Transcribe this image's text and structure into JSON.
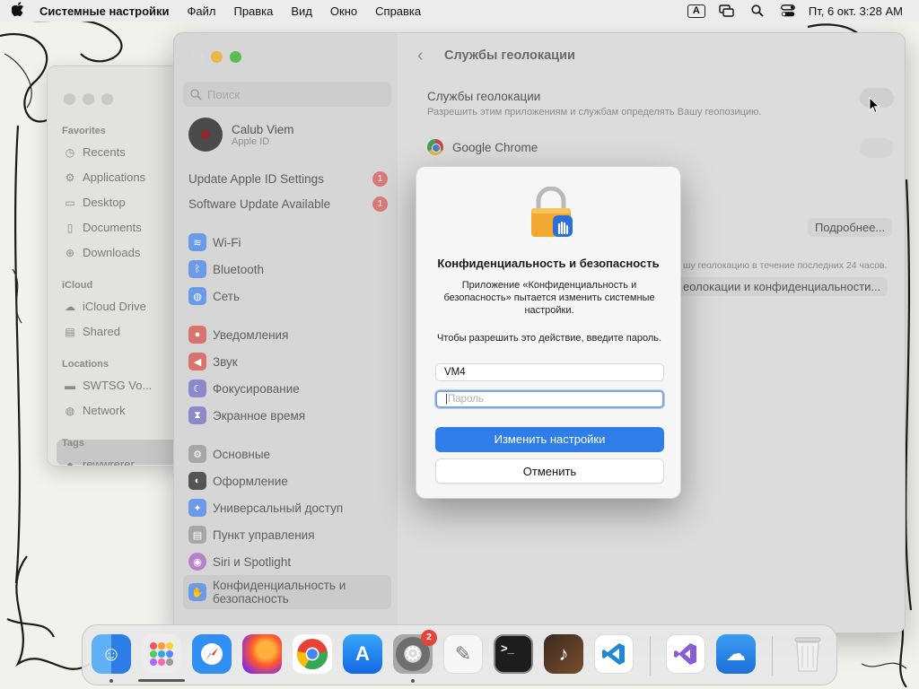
{
  "menubar": {
    "app_name": "Системные настройки",
    "menus": [
      "Файл",
      "Правка",
      "Вид",
      "Окно",
      "Справка"
    ],
    "input_badge": "A",
    "clock": "Пт, 6 окт.  3:28 AM"
  },
  "finder": {
    "sections": [
      {
        "title": "Favorites",
        "items": [
          "Recents",
          "Applications",
          "Desktop",
          "Documents",
          "Downloads"
        ]
      },
      {
        "title": "iCloud",
        "items": [
          "iCloud Drive",
          "Shared"
        ]
      },
      {
        "title": "Locations",
        "items": [
          "SWTSG Vo...",
          "Network"
        ]
      },
      {
        "title": "Tags",
        "items": [
          "rewwrerer"
        ]
      }
    ]
  },
  "settings": {
    "search_placeholder": "Поиск",
    "profile": {
      "name": "Calub Viem",
      "sub": "Apple ID"
    },
    "notices": [
      {
        "label": "Update Apple ID Settings",
        "count": "1"
      },
      {
        "label": "Software Update Available",
        "count": "1"
      }
    ],
    "sidebar_items": [
      {
        "label": "Wi-Fi",
        "icon": "wifi-icon",
        "color": "#3b82f6"
      },
      {
        "label": "Bluetooth",
        "icon": "bluetooth-icon",
        "color": "#3b82f6"
      },
      {
        "label": "Сеть",
        "icon": "globe-icon",
        "color": "#3b82f6"
      },
      {
        "label": "Уведомления",
        "icon": "bell-icon",
        "color": "#e5453b"
      },
      {
        "label": "Звук",
        "icon": "speaker-icon",
        "color": "#e5453b"
      },
      {
        "label": "Фокусирование",
        "icon": "moon-icon",
        "color": "#5856d6"
      },
      {
        "label": "Экранное время",
        "icon": "hourglass-icon",
        "color": "#5856d6"
      },
      {
        "label": "Основные",
        "icon": "gear-icon",
        "color": "#8e8e93"
      },
      {
        "label": "Оформление",
        "icon": "appearance-icon",
        "color": "#1c1c1e"
      },
      {
        "label": "Универсальный доступ",
        "icon": "accessibility-icon",
        "color": "#1a7cf5"
      },
      {
        "label": "Пункт управления",
        "icon": "control-center-icon",
        "color": "#8e8e93"
      },
      {
        "label": "Siri и Spotlight",
        "icon": "siri-icon",
        "color": "#c543c9"
      },
      {
        "label": "Конфиденциальность и безопасность",
        "icon": "hand-icon",
        "color": "#1a7cf5"
      }
    ],
    "page_title": "Службы геолокации",
    "location_title": "Службы геолокации",
    "location_sub": "Разрешить этим приложениям и службам определять Вашу геопозицию.",
    "chrome_label": "Google Chrome",
    "details_button": "Подробнее...",
    "system_note": "шу геолокацию в течение последних 24 часов.",
    "privacy_button": "еолокации и конфиденциальности..."
  },
  "modal": {
    "title": "Конфиденциальность и безопасность",
    "message": "Приложение «Конфиденциальность и безопасность» пытается изменить системные настройки.",
    "message2": "Чтобы разрешить это действие, введите пароль.",
    "username_value": "VM4",
    "password_placeholder": "Пароль",
    "confirm_label": "Изменить настройки",
    "cancel_label": "Отменить"
  },
  "dock": {
    "apps": [
      {
        "name": "finder-icon",
        "color": "#3a8ef0",
        "running": true
      },
      {
        "name": "launchpad-icon",
        "color": "#ededed",
        "running": false
      },
      {
        "name": "safari-icon",
        "color": "#2f8ff2",
        "running": false
      },
      {
        "name": "firefox-icon",
        "color": "#a43bd6",
        "running": false
      },
      {
        "name": "chrome-icon",
        "color": "#ffffff",
        "running": false
      },
      {
        "name": "app-store-icon",
        "color": "#1d8cf2",
        "running": false
      },
      {
        "name": "system-settings-icon",
        "color": "#7a7a7a",
        "running": true,
        "badge": "2"
      },
      {
        "name": "textedit-icon",
        "color": "#f6f6f6",
        "running": false
      },
      {
        "name": "terminal-icon",
        "color": "#1d1d1d",
        "running": false
      },
      {
        "name": "instruments-icon",
        "color": "#5a3b27",
        "running": false
      },
      {
        "name": "vscode-icon",
        "color": "#ffffff",
        "running": false
      },
      {
        "name": "visual-studio-icon",
        "color": "#ffffff",
        "running": false
      },
      {
        "name": "weather-icon",
        "color": "#2d8ff0",
        "running": false
      },
      {
        "name": "trash-icon",
        "color": "#e8e8e8",
        "running": false
      }
    ]
  }
}
